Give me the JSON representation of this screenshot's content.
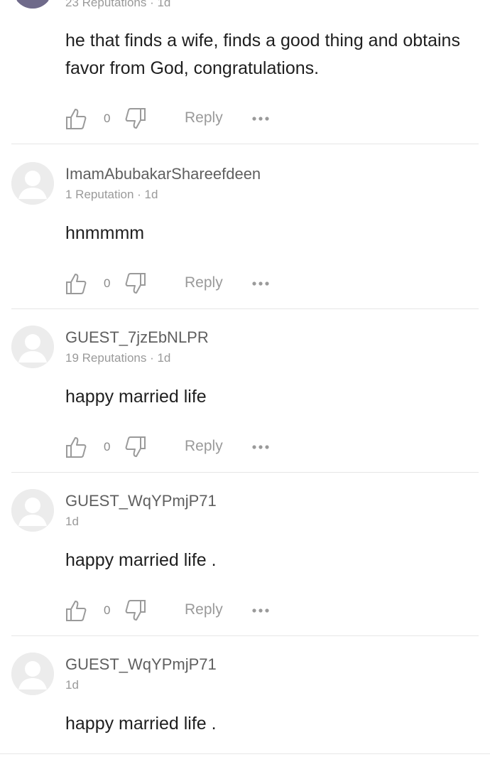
{
  "comments": [
    {
      "username": "",
      "meta": "23 Reputations · 1d",
      "text": "he that finds a wife, finds a  good thing and obtains favor from God, congratulations.",
      "likes": "0",
      "reply_label": "Reply",
      "avatar_icon": "user-photo-avatar"
    },
    {
      "username": "ImamAbubakarShareefdeen",
      "meta": "1 Reputation · 1d",
      "text": "hnmmmm",
      "likes": "0",
      "reply_label": "Reply",
      "avatar_icon": "default-user-avatar"
    },
    {
      "username": "GUEST_7jzEbNLPR",
      "meta": "19 Reputations · 1d",
      "text": "happy married life",
      "likes": "0",
      "reply_label": "Reply",
      "avatar_icon": "default-user-avatar"
    },
    {
      "username": "GUEST_WqYPmjP71",
      "meta": "1d",
      "text": "happy married life .",
      "likes": "0",
      "reply_label": "Reply",
      "avatar_icon": "default-user-avatar"
    },
    {
      "username": "GUEST_WqYPmjP71",
      "meta": "1d",
      "text": "happy married life .",
      "avatar_icon": "default-user-avatar"
    }
  ],
  "icons": {
    "like": "thumbs-up-icon",
    "dislike": "thumbs-down-icon",
    "more": "more-dots-icon"
  },
  "colors": {
    "username": "#5f5f5f",
    "meta": "#9a9a9a",
    "body_text": "#1f1f1f",
    "icon": "#9a9a9a",
    "divider": "#e6e6e6",
    "avatar_bg": "#ececec"
  }
}
